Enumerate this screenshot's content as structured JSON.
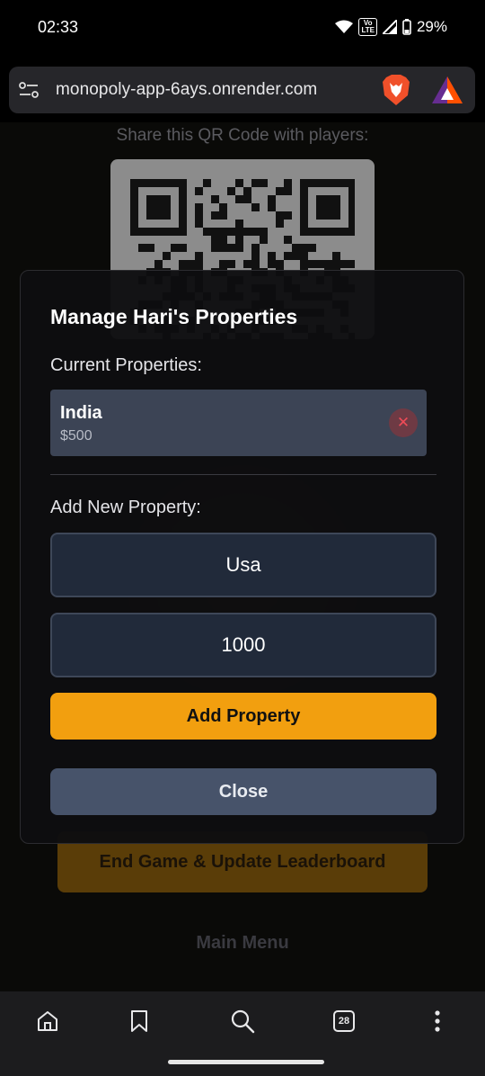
{
  "status_bar": {
    "time": "02:33",
    "network_badge": "Vo LTE",
    "battery": "29%"
  },
  "browser": {
    "url": "monopoly-app-6ays.onrender.com",
    "tab_count": "28",
    "icons": {
      "site_settings": "site-settings-icon",
      "brave": "brave-lion-icon",
      "rewards": "bat-rewards-icon"
    }
  },
  "page": {
    "share_text": "Share this QR Code with players:",
    "end_game_label": "End Game & Update Leaderboard",
    "main_menu_label": "Main Menu"
  },
  "modal": {
    "title": "Manage Hari's Properties",
    "current_label": "Current Properties:",
    "properties": [
      {
        "name": "India",
        "price": "$500"
      }
    ],
    "add_label": "Add New Property:",
    "name_input_value": "Usa",
    "price_input_value": "1000",
    "add_button": "Add Property",
    "close_button": "Close"
  },
  "colors": {
    "accent": "#f29f0f",
    "close_button": "#47536a",
    "property_card": "#3c4455",
    "remove": "#ef4b57"
  }
}
